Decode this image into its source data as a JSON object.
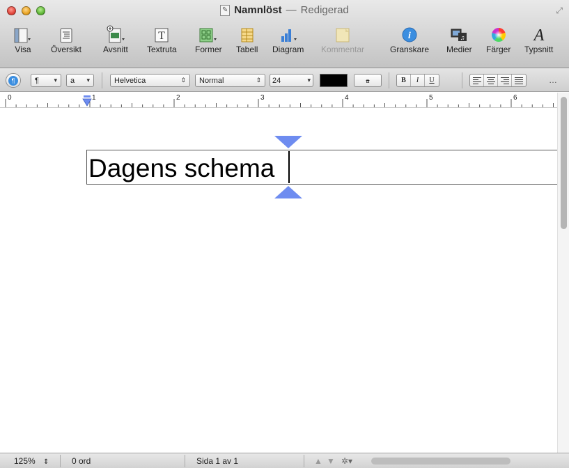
{
  "window": {
    "title": "Namnlöst",
    "title_separator": "—",
    "state": "Redigerad"
  },
  "toolbar": {
    "items": [
      {
        "label": "Visa",
        "icon": "view-icon"
      },
      {
        "label": "Översikt",
        "icon": "outline-icon"
      },
      {
        "label": "Avsnitt",
        "icon": "section-icon"
      },
      {
        "label": "Textruta",
        "icon": "textbox-icon"
      },
      {
        "label": "Former",
        "icon": "shapes-icon"
      },
      {
        "label": "Tabell",
        "icon": "table-icon"
      },
      {
        "label": "Diagram",
        "icon": "chart-icon"
      },
      {
        "label": "Kommentar",
        "icon": "comment-icon",
        "disabled": true
      },
      {
        "label": "Granskare",
        "icon": "inspector-icon"
      },
      {
        "label": "Medier",
        "icon": "media-icon"
      },
      {
        "label": "Färger",
        "icon": "colors-icon"
      },
      {
        "label": "Typsnitt",
        "icon": "fonts-icon"
      }
    ]
  },
  "formatbar": {
    "paragraph_style_glyph": "¶",
    "char_style_glyph": "a",
    "font_family": "Helvetica",
    "font_style": "Normal",
    "font_size": "24",
    "text_color": "#000000",
    "highlight_glyph": "a",
    "bold": "B",
    "italic": "I",
    "underline": "U"
  },
  "ruler": {
    "labels": [
      "0",
      "1",
      "2",
      "3",
      "4",
      "5",
      "6"
    ]
  },
  "document": {
    "text": "Dagens schema"
  },
  "statusbar": {
    "zoom": "125%",
    "word_count": "0 ord",
    "page": "Sida 1 av 1"
  },
  "colors": {
    "handle": "#6e8cf0",
    "accent": "#3b8ee0"
  }
}
